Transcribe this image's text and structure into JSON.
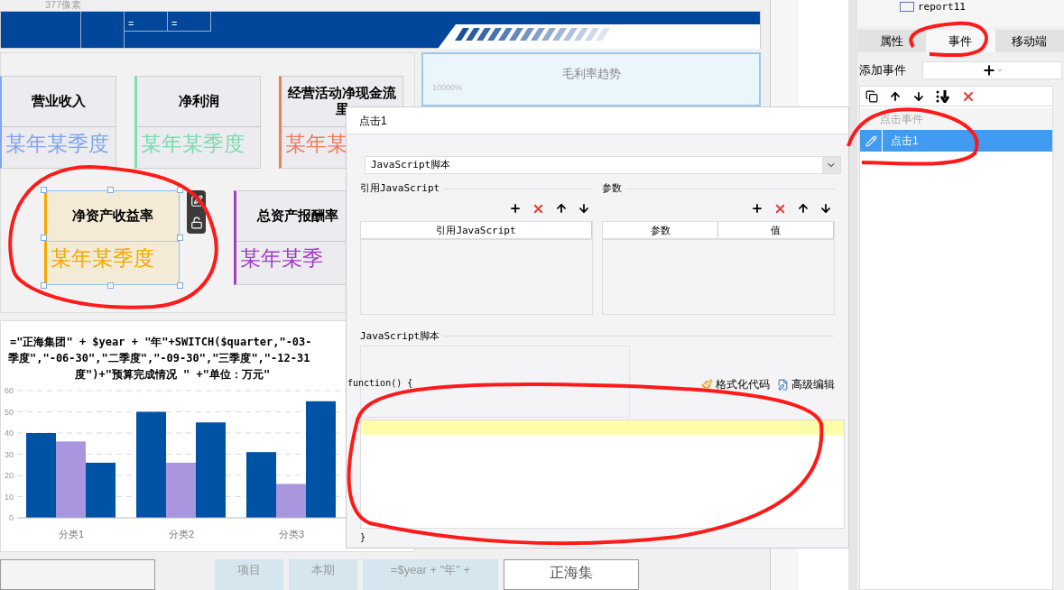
{
  "ruler_label": "377像素",
  "header_band": {
    "cells": [
      "=",
      "="
    ]
  },
  "kpi_cards": [
    {
      "title_lines": [
        "营业收入"
      ],
      "value": "某年某季度",
      "color": "#7fa6ee",
      "selected": false
    },
    {
      "title_lines": [
        "净利润"
      ],
      "value": "某年某季度",
      "color": "#7ddcb0",
      "selected": false
    },
    {
      "title_lines": [
        "经营活动净现金流",
        "里"
      ],
      "value": "某年某",
      "color": "#f07a5c",
      "selected": false
    },
    {
      "title_lines": [
        "净资产收益率"
      ],
      "value": "某年某季度",
      "color": "#f5a800",
      "selected": true
    },
    {
      "title_lines": [
        "总资产报酬率"
      ],
      "value": "某年某季",
      "color": "#a23dc4",
      "selected": false
    }
  ],
  "trend_card": {
    "title": "毛利率趋势",
    "axis_label": "10000%"
  },
  "bar_chart": {
    "formula_lines": [
      "=\"正海集团\" + $year + \"年\"+SWITCH($quarter,\"-03-",
      "季度\",\"-06-30\",\"二季度\",\"-09-30\",\"三季度\",\"-12-31",
      "度\")+\"预算完成情况      \" +\"单位：万元\""
    ],
    "chart_data": {
      "type": "bar",
      "categories": [
        "分类1",
        "分类2",
        "分类3"
      ],
      "series": [
        {
          "color": "#0052a5",
          "values": [
            40,
            50,
            31
          ]
        },
        {
          "color": "#a996de",
          "values": [
            36,
            26,
            16
          ]
        },
        {
          "color": "#0052a5",
          "values": [
            26,
            45,
            55
          ]
        }
      ],
      "ylim": [
        0,
        60
      ],
      "grid": true,
      "yticks": [
        0,
        10,
        20,
        30,
        40,
        50,
        60
      ]
    }
  },
  "bottom_row": {
    "cells": [
      "项目",
      "本期",
      "=$year + \"年\" +",
      "正海集"
    ]
  },
  "dialog": {
    "title": "点击1",
    "type_select": "JavaScript脚本",
    "ref_section": {
      "label": "引用JavaScript",
      "columns": [
        "引用JavaScript"
      ]
    },
    "param_section": {
      "label": "参数",
      "columns": [
        "参数",
        "值"
      ]
    },
    "script_section": {
      "label": "JavaScript脚本",
      "header": "function() {",
      "footer": "}",
      "actions": [
        "格式化代码",
        "高级编辑"
      ]
    }
  },
  "right_panel": {
    "tree_item": "report11",
    "tabs": [
      {
        "label": "属性",
        "selected": false
      },
      {
        "label": "事件",
        "selected": true
      },
      {
        "label": "移动端",
        "selected": false
      }
    ],
    "add_event_label": "添加事件",
    "event_group": "点击事件",
    "events": [
      {
        "label": "点击1",
        "selected": true
      }
    ]
  }
}
